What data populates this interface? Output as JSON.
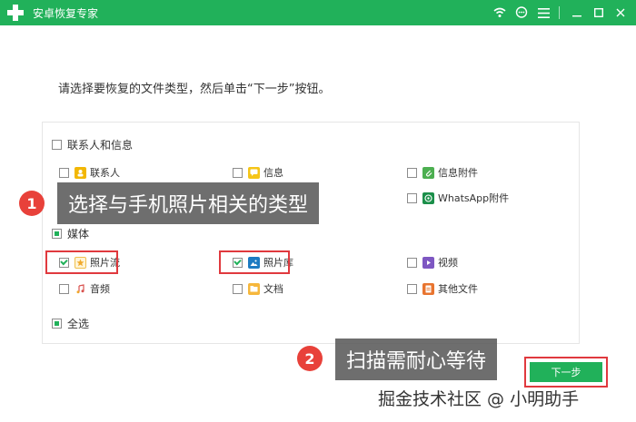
{
  "app": {
    "title": "安卓恢复专家"
  },
  "instruction": "请选择要恢复的文件类型，然后单击“下一步”按钮。",
  "groups": [
    {
      "label": "联系人和信息",
      "items": [
        {
          "label": "联系人"
        },
        {
          "label": "信息"
        },
        {
          "label": "信息附件"
        },
        {
          "label": "WhatsApp附件"
        }
      ]
    },
    {
      "label": "媒体",
      "items": [
        {
          "label": "照片流"
        },
        {
          "label": "照片库"
        },
        {
          "label": "视频"
        },
        {
          "label": "音频"
        },
        {
          "label": "文档"
        },
        {
          "label": "其他文件"
        }
      ]
    }
  ],
  "select_all": "全选",
  "next_button": "下一步",
  "callouts": [
    {
      "num": "1",
      "text": "选择与手机照片相关的类型"
    },
    {
      "num": "2",
      "text": "扫描需耐心等待"
    }
  ],
  "watermark": "掘金技术社区 @ 小明助手",
  "colors": {
    "brand": "#21b15a",
    "highlight": "#e0393e",
    "callout_badge": "#e8413a"
  }
}
